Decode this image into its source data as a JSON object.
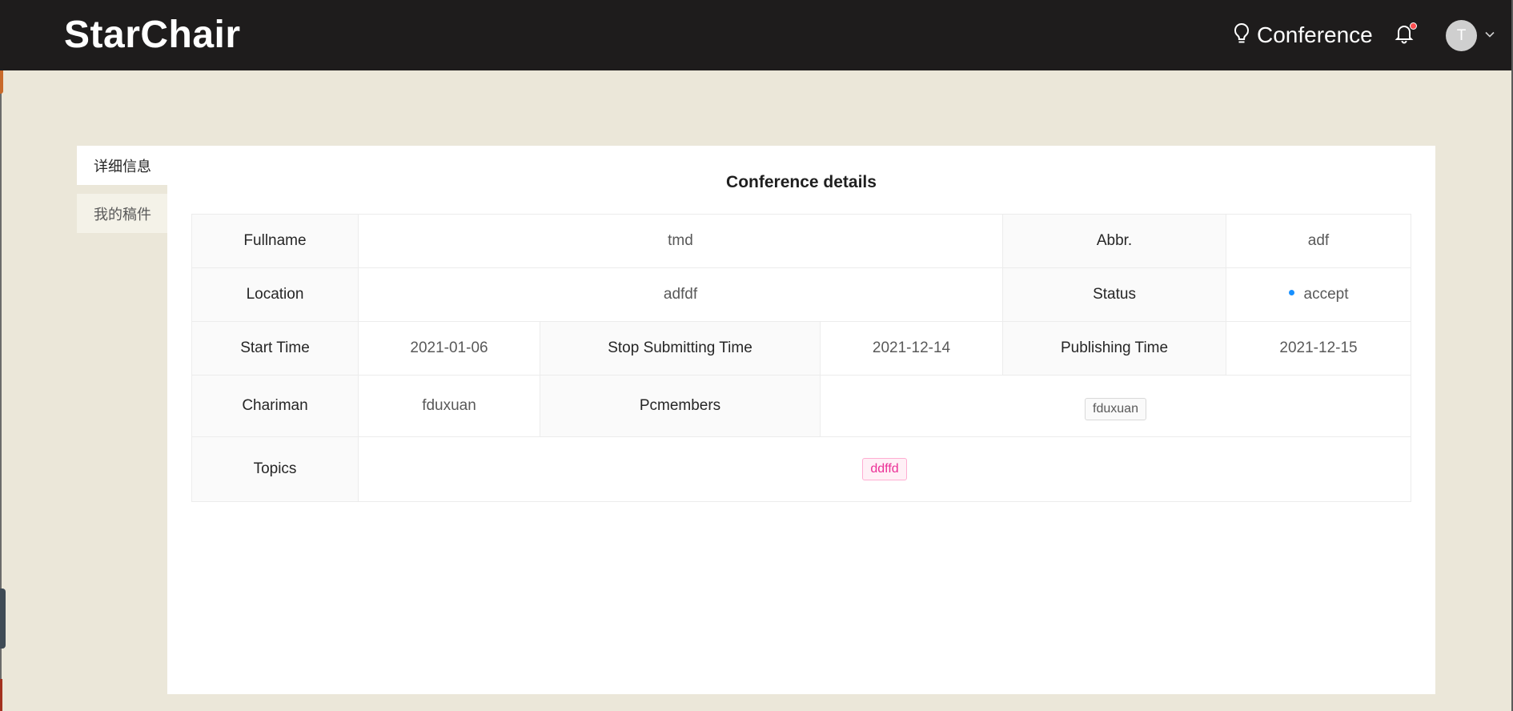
{
  "header": {
    "logo": "StarChair",
    "nav_conference_label": "Conference",
    "avatar_letter": "T"
  },
  "side_tabs": [
    {
      "label": "详细信息",
      "active": true
    },
    {
      "label": "我的稿件",
      "active": false
    }
  ],
  "panel": {
    "title": "Conference details"
  },
  "details": {
    "fullname_label": "Fullname",
    "fullname_value": "tmd",
    "abbr_label": "Abbr.",
    "abbr_value": "adf",
    "location_label": "Location",
    "location_value": "adfdf",
    "status_label": "Status",
    "status_value": "accept",
    "start_time_label": "Start Time",
    "start_time_value": "2021-01-06",
    "stop_submitting_label": "Stop Submitting Time",
    "stop_submitting_value": "2021-12-14",
    "publishing_time_label": "Publishing Time",
    "publishing_time_value": "2021-12-15",
    "chairman_label": "Chariman",
    "chairman_value": "fduxuan",
    "pcmembers_label": "Pcmembers",
    "pcmembers_tags": [
      "fduxuan"
    ],
    "topics_label": "Topics",
    "topics_tags": [
      "ddffd"
    ]
  },
  "colors": {
    "header_bg": "#1e1c1c",
    "page_bg": "#ebe7d9",
    "status_dot": "#1890ff",
    "notification_dot": "#ff4d4f",
    "topic_tag": "#eb2f96"
  },
  "icons": {
    "conference_icon": "lightbulb-icon",
    "notification_icon": "bell-icon",
    "avatar_dropdown": "chevron-down-icon"
  }
}
